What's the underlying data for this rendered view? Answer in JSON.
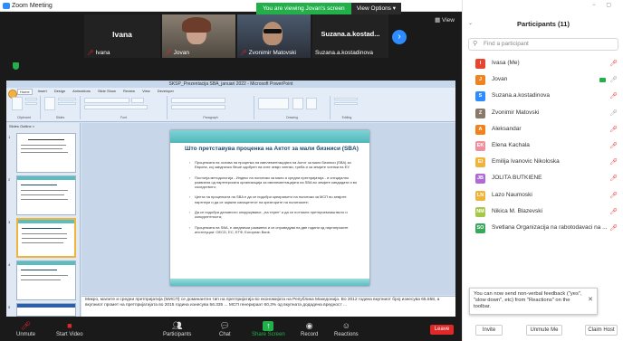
{
  "window": {
    "title": "Zoom Meeting"
  },
  "banner": {
    "viewing": "You are viewing Jovan's screen",
    "options": "View Options ▾"
  },
  "gallery": {
    "view_label": "View",
    "tiles": [
      {
        "center_name": "Ivana",
        "label": "Ivana"
      },
      {
        "label": "Jovan"
      },
      {
        "label": "Zvonimir Matovski"
      },
      {
        "center_name": "Suzana.a.kostad...",
        "label": "Suzana.a.kostadinova"
      }
    ],
    "next_icon": "chevron-right-icon"
  },
  "powerpoint": {
    "title": "SKSP_Prezentacija SBA_januari 2022 - Microsoft PowerPoint",
    "tabs": [
      "Home",
      "Insert",
      "Design",
      "Animations",
      "Slide Show",
      "Review",
      "View",
      "Developer"
    ],
    "ribbon_groups": [
      "Clipboard",
      "Slides",
      "Font",
      "Paragraph",
      "Drawing",
      "Editing"
    ],
    "panel_tabs": "Slides  Outline  ×",
    "slide_numbers": [
      "1",
      "2",
      "3",
      "4",
      "5",
      "6"
    ],
    "slide": {
      "title": "Што претставува проценка на Актот за мали бизниси (SBA)",
      "bullets": [
        "Проценката на основа на проценка на имплементацијата на Актот за мали бизниси (SBA) за Европа, кој заедничко беше одобрен на сите земји членки, треба и за земјите членки на ЕУ.",
        "Постоеја методологија - Индекс на политики за мали и средни претпријатија - и специјално развиена од партнерската организација за имплементацијата на SBA во земјите кандидати и во соседството;",
        "Целта на проценката на SBA е да се подобри креирањето на политики за МСП во земјите партнери и да се зајакне капацитетот на креаторите на политиките;",
        "Да се подобри деловното опкружување, „на терен“ и да се поттикне претприемништвото и конкурентноста;",
        "Проценката на SBA, е заеднички развиена и се спроведува на две години од партнерските институции: OECD, ЕС, ЕТФ, European Bank."
      ]
    },
    "notes": "Микро, малите и средни претпријатија (МИСП) се доминантен тип на претпријатија во економијата на Република Македонија. Во 2012 година вкупниот број изнесува 65.558, а вкупниот промет на претпријатијата во 2015 година изнесува 56.335 ... МСП генерираат 60,3% од вкупната додадена вредност ..."
  },
  "toolbar": {
    "items": [
      {
        "label": "Unmute",
        "icon": "microphone-muted-icon"
      },
      {
        "label": "Start Video",
        "icon": "video-off-icon"
      },
      {
        "label": "Participants",
        "icon": "participants-icon"
      },
      {
        "label": "Chat",
        "icon": "chat-icon"
      },
      {
        "label": "Share Screen",
        "icon": "share-screen-icon"
      },
      {
        "label": "Record",
        "icon": "record-icon"
      },
      {
        "label": "Reactions",
        "icon": "reactions-icon"
      }
    ],
    "leave_label": "Leave"
  },
  "participants": {
    "title": "Participants (11)",
    "search_placeholder": "Find a participant",
    "list": [
      {
        "initial": "I",
        "color": "#e8452e",
        "name": "Ivasa (Me)",
        "muted": true
      },
      {
        "initial": "J",
        "color": "#f0821f",
        "name": "Jovan",
        "muted": false,
        "video": true
      },
      {
        "initial": "S",
        "color": "#2d8cff",
        "name": "Suzana.a.kostadinova",
        "muted": true
      },
      {
        "initial": "Z",
        "color": "#8a7966",
        "name": "Zvonimir Matovski",
        "muted": false
      },
      {
        "initial": "A",
        "color": "#f0821f",
        "name": "Aleksandar",
        "muted": true
      },
      {
        "initial": "EK",
        "color": "#f08fa0",
        "name": "Elena Kachala",
        "muted": true
      },
      {
        "initial": "EI",
        "color": "#f0b43c",
        "name": "Emilija Ivanovic Nikoloska",
        "muted": true
      },
      {
        "initial": "JB",
        "color": "#b06ad6",
        "name": "JOLITA BUTKIENE",
        "muted": true
      },
      {
        "initial": "LN",
        "color": "#f0b43c",
        "name": "Lazo Naumoski",
        "muted": true
      },
      {
        "initial": "NM",
        "color": "#a6c84a",
        "name": "Nikica M. Blazevski",
        "muted": true
      },
      {
        "initial": "SO",
        "color": "#3aa75a",
        "name": "Svetlana Organizacija na rabotodavaci na ...",
        "muted": true
      }
    ],
    "toast": "You can now send non-verbal feedback (\"yes\", \"slow down\", etc) from \"Reactions\" on the toolbar.",
    "footer": [
      "Invite",
      "Unmute Me",
      "Claim Host"
    ]
  },
  "colors": {
    "zoom_blue": "#2d8cff",
    "share_green": "#23b04b",
    "leave_red": "#e02828"
  }
}
